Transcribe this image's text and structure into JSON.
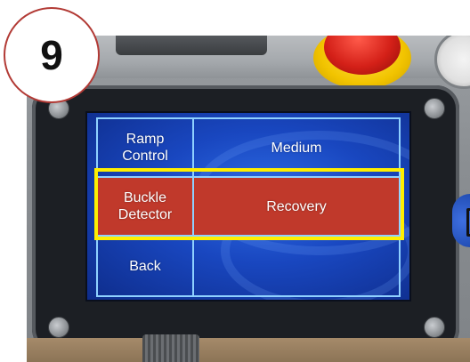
{
  "step_badge": {
    "number": "9"
  },
  "menu": {
    "rows": [
      {
        "label": "Ramp Control",
        "value": "Medium",
        "selected": false
      },
      {
        "label": "Buckle Detector",
        "value": "Recovery",
        "selected": true
      },
      {
        "label": "Back",
        "value": "",
        "selected": false
      }
    ]
  },
  "colors": {
    "screen_blue": "#1947c0",
    "grid_line": "#8fd1ff",
    "selected_row": "#c0392b",
    "highlight_box": "#ffee00",
    "badge_border": "#b23a35"
  },
  "icons": [
    "emergency-stop-button",
    "pressure-gauge",
    "side-blue-button",
    "screw"
  ]
}
